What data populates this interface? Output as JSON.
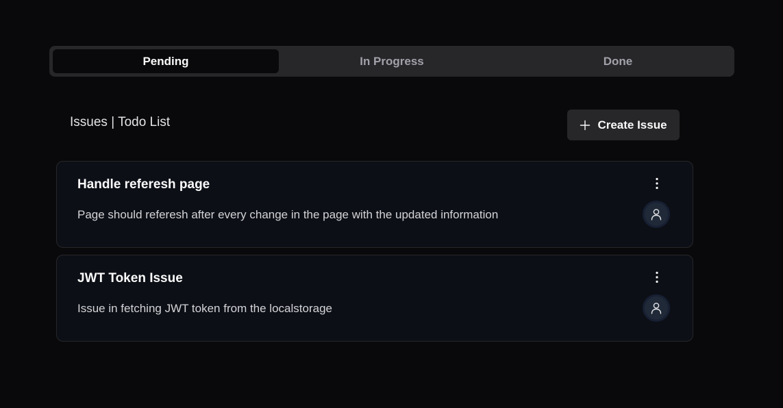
{
  "tabs": [
    {
      "label": "Pending",
      "active": true
    },
    {
      "label": "In Progress",
      "active": false
    },
    {
      "label": "Done",
      "active": false
    }
  ],
  "header": {
    "title": "Issues | Todo List",
    "create_button_label": "Create Issue",
    "create_button_icon": "plus-icon"
  },
  "issues": [
    {
      "title": "Handle referesh page",
      "description": "Page should referesh after every change in the page with the updated information",
      "menu_icon": "more-vertical-icon",
      "avatar_icon": "user-icon"
    },
    {
      "title": "JWT Token Issue",
      "description": "Issue in fetching JWT token from the localstorage",
      "menu_icon": "more-vertical-icon",
      "avatar_icon": "user-icon"
    }
  ],
  "colors": {
    "background": "#09090b",
    "tab_bar": "#27272a",
    "active_tab": "#09090b",
    "card": "#0c0f16",
    "card_border": "#27272a",
    "button": "#27272a"
  }
}
